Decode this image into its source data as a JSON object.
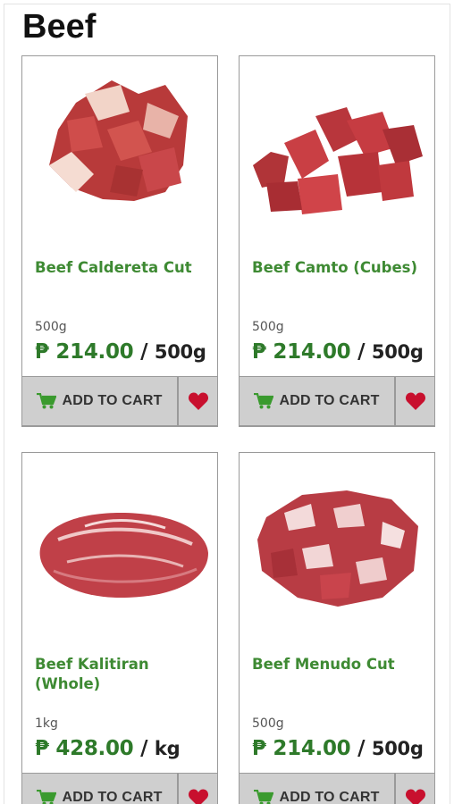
{
  "section": {
    "title": "Beef"
  },
  "currency_symbol": "₱",
  "buttons": {
    "add_to_cart_label": "ADD TO CART"
  },
  "colors": {
    "name_green": "#3e8a33",
    "price_green": "#2e7a2a",
    "cart_icon": "#3a9a2e",
    "heart": "#c8102e",
    "button_bg": "#cfcfcf"
  },
  "products": [
    {
      "name": "Beef Caldereta Cut",
      "weight": "500g",
      "price": "₱ 214.00",
      "price_sep": "/",
      "price_unit": "500g",
      "image_icon": "beef-chunks-image"
    },
    {
      "name": "Beef Camto (Cubes)",
      "weight": "500g",
      "price": "₱ 214.00",
      "price_sep": "/",
      "price_unit": "500g",
      "image_icon": "beef-cubes-image"
    },
    {
      "name": "Beef Kalitiran (Whole)",
      "weight": "1kg",
      "price": "₱ 428.00",
      "price_sep": "/",
      "price_unit": "kg",
      "image_icon": "beef-whole-image"
    },
    {
      "name": "Beef Menudo Cut",
      "weight": "500g",
      "price": "₱ 214.00",
      "price_sep": "/",
      "price_unit": "500g",
      "image_icon": "beef-menudo-image"
    }
  ]
}
